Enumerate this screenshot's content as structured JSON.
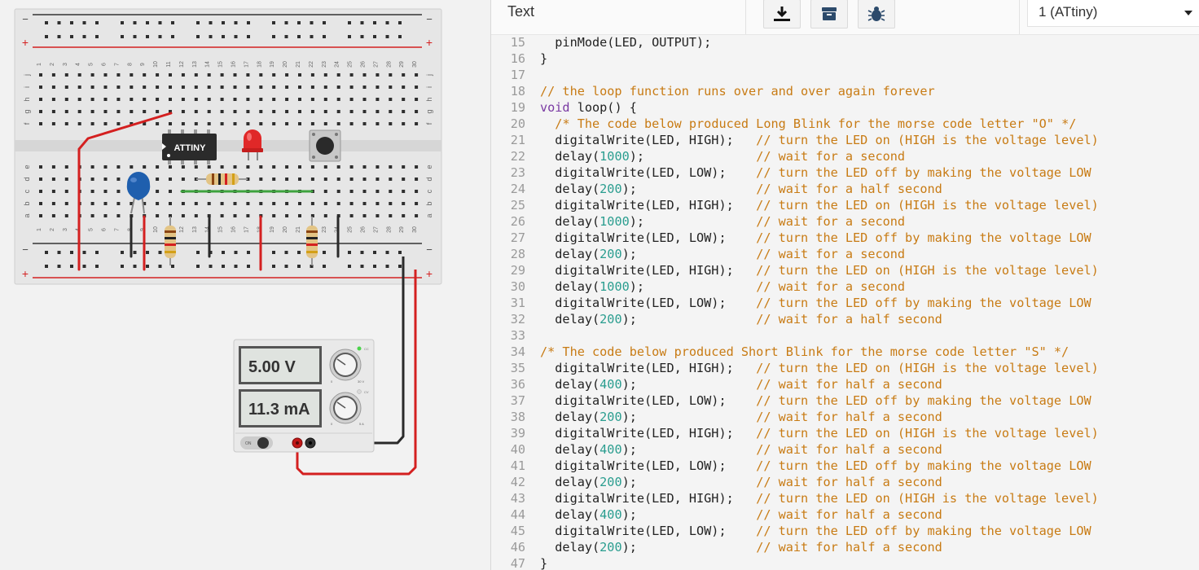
{
  "toolbar": {
    "mode_label": "Text",
    "buttons": [
      {
        "name": "download",
        "icon": "download-icon"
      },
      {
        "name": "libraries",
        "icon": "archive-icon"
      },
      {
        "name": "debugger",
        "icon": "bug-icon"
      }
    ],
    "device_select": "1 (ATtiny)"
  },
  "breadboard": {
    "column_numbers": [
      "1",
      "2",
      "3",
      "4",
      "5",
      "6",
      "7",
      "8",
      "9",
      "10",
      "11",
      "12",
      "13",
      "14",
      "15",
      "16",
      "17",
      "18",
      "19",
      "20",
      "21",
      "22",
      "23",
      "24",
      "25",
      "26",
      "27",
      "28",
      "29",
      "30"
    ],
    "rail_minus": "−",
    "rail_plus": "+",
    "row_letters_top": [
      "j",
      "i",
      "h",
      "g",
      "f"
    ],
    "row_letters_bottom": [
      "e",
      "d",
      "c",
      "b",
      "a"
    ],
    "chip_label": "ATTINY"
  },
  "power_supply": {
    "voltage": "5.00 V",
    "current": "11.3 mA",
    "switch_label": "ON",
    "cc_label": "CC",
    "cv_label": "CV",
    "dial_min": "0",
    "voltage_max": "30 V",
    "current_max": "5 A"
  },
  "colors": {
    "wire_red": "#d42020",
    "wire_black": "#2a2a2a",
    "wire_green": "#3ea33e",
    "led_red": "#e02828",
    "capacitor_blue": "#1f5fae",
    "comment": "#c87b14",
    "number": "#2a9d8f",
    "keyword": "#7a3aa3"
  },
  "code_lines": [
    {
      "n": "15",
      "text": "  pinMode(LED, OUTPUT);"
    },
    {
      "n": "16",
      "text": "}"
    },
    {
      "n": "17",
      "text": ""
    },
    {
      "n": "18",
      "text": "// the loop function runs over and over again forever"
    },
    {
      "n": "19",
      "text": "void loop() {"
    },
    {
      "n": "20",
      "text": "  /* The code below produced Long Blink for the morse code letter \"O\" */"
    },
    {
      "n": "21",
      "text": "  digitalWrite(LED, HIGH);   // turn the LED on (HIGH is the voltage level)"
    },
    {
      "n": "22",
      "text": "  delay(1000);               // wait for a second"
    },
    {
      "n": "23",
      "text": "  digitalWrite(LED, LOW);    // turn the LED off by making the voltage LOW"
    },
    {
      "n": "24",
      "text": "  delay(200);                // wait for a half second"
    },
    {
      "n": "25",
      "text": "  digitalWrite(LED, HIGH);   // turn the LED on (HIGH is the voltage level)"
    },
    {
      "n": "26",
      "text": "  delay(1000);               // wait for a second"
    },
    {
      "n": "27",
      "text": "  digitalWrite(LED, LOW);    // turn the LED off by making the voltage LOW"
    },
    {
      "n": "28",
      "text": "  delay(200);                // wait for a second"
    },
    {
      "n": "29",
      "text": "  digitalWrite(LED, HIGH);   // turn the LED on (HIGH is the voltage level)"
    },
    {
      "n": "30",
      "text": "  delay(1000);               // wait for a second"
    },
    {
      "n": "31",
      "text": "  digitalWrite(LED, LOW);    // turn the LED off by making the voltage LOW"
    },
    {
      "n": "32",
      "text": "  delay(200);                // wait for a half second"
    },
    {
      "n": "33",
      "text": ""
    },
    {
      "n": "34",
      "text": "/* The code below produced Short Blink for the morse code letter \"S\" */"
    },
    {
      "n": "35",
      "text": "  digitalWrite(LED, HIGH);   // turn the LED on (HIGH is the voltage level)"
    },
    {
      "n": "36",
      "text": "  delay(400);                // wait for half a second"
    },
    {
      "n": "37",
      "text": "  digitalWrite(LED, LOW);    // turn the LED off by making the voltage LOW"
    },
    {
      "n": "38",
      "text": "  delay(200);                // wait for half a second"
    },
    {
      "n": "39",
      "text": "  digitalWrite(LED, HIGH);   // turn the LED on (HIGH is the voltage level)"
    },
    {
      "n": "40",
      "text": "  delay(400);                // wait for half a second"
    },
    {
      "n": "41",
      "text": "  digitalWrite(LED, LOW);    // turn the LED off by making the voltage LOW"
    },
    {
      "n": "42",
      "text": "  delay(200);                // wait for half a second"
    },
    {
      "n": "43",
      "text": "  digitalWrite(LED, HIGH);   // turn the LED on (HIGH is the voltage level)"
    },
    {
      "n": "44",
      "text": "  delay(400);                // wait for half a second"
    },
    {
      "n": "45",
      "text": "  digitalWrite(LED, LOW);    // turn the LED off by making the voltage LOW"
    },
    {
      "n": "46",
      "text": "  delay(200);                // wait for half a second"
    },
    {
      "n": "47",
      "text": "}"
    }
  ]
}
